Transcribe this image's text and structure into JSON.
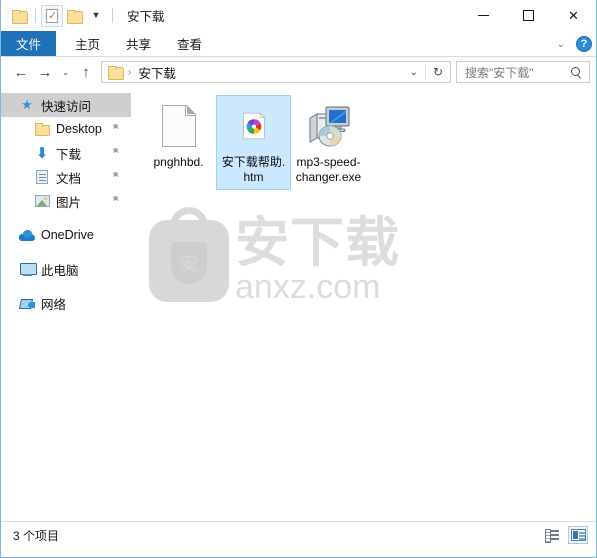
{
  "window": {
    "title": "安下载",
    "controls": {
      "minimize": "—",
      "maximize": "□",
      "close": "✕"
    }
  },
  "quick_access_toolbar": {
    "items": [
      {
        "name": "folder-icon",
        "label": ""
      },
      {
        "name": "properties-icon",
        "label": ""
      },
      {
        "name": "new-folder-icon",
        "label": ""
      },
      {
        "name": "customize-dropdown-icon",
        "label": "▼"
      }
    ]
  },
  "ribbon": {
    "tabs": [
      {
        "label": "文件",
        "active": true
      },
      {
        "label": "主页",
        "active": false
      },
      {
        "label": "共享",
        "active": false
      },
      {
        "label": "查看",
        "active": false
      }
    ],
    "expand_icon": "⌄",
    "help_icon": "?"
  },
  "address_bar": {
    "back_icon": "←",
    "forward_icon": "→",
    "recent_icon": "⌄",
    "up_icon": "↑",
    "breadcrumb": {
      "separator": "›",
      "path": "安下载"
    },
    "dropdown_icon": "⌄",
    "refresh_icon": "↻",
    "search_placeholder": "搜索\"安下载\""
  },
  "sidebar": {
    "items": [
      {
        "label": "快速访问",
        "icon": "star-icon",
        "selected": true,
        "pinned": false,
        "child": false
      },
      {
        "label": "Desktop",
        "icon": "folder-icon",
        "selected": false,
        "pinned": true,
        "child": true
      },
      {
        "label": "下载",
        "icon": "download-icon",
        "selected": false,
        "pinned": true,
        "child": true
      },
      {
        "label": "文档",
        "icon": "documents-icon",
        "selected": false,
        "pinned": true,
        "child": true
      },
      {
        "label": "图片",
        "icon": "pictures-icon",
        "selected": false,
        "pinned": true,
        "child": true
      },
      {
        "label": "OneDrive",
        "icon": "cloud-icon",
        "selected": false,
        "pinned": false,
        "child": false
      },
      {
        "label": "此电脑",
        "icon": "computer-icon",
        "selected": false,
        "pinned": false,
        "child": false
      },
      {
        "label": "网络",
        "icon": "network-icon",
        "selected": false,
        "pinned": false,
        "child": false
      }
    ],
    "pin_glyph": "📌"
  },
  "content": {
    "files": [
      {
        "label": "pnghhbd.",
        "icon": "blank-document-icon",
        "selected": false
      },
      {
        "label": "安下载帮助.htm",
        "icon": "html-pinwheel-icon",
        "selected": true
      },
      {
        "label": "mp3-speed-changer.exe",
        "icon": "setup-installer-icon",
        "selected": false
      }
    ],
    "watermark": {
      "logo_char": "安",
      "cn_text": "安下载",
      "en_text": "anxz.com"
    }
  },
  "status_bar": {
    "item_count": "3 个项目",
    "views": [
      {
        "name": "details-view-button",
        "active": false
      },
      {
        "name": "large-icons-view-button",
        "active": true
      }
    ]
  },
  "colors": {
    "accent_blue": "#1e72b8",
    "selection_fill": "#cce8ff",
    "selection_border": "#99d1ff",
    "window_border": "#7ab8dd",
    "nav_selected": "#cfcfcf",
    "folder_yellow": "#fbdf9a"
  }
}
